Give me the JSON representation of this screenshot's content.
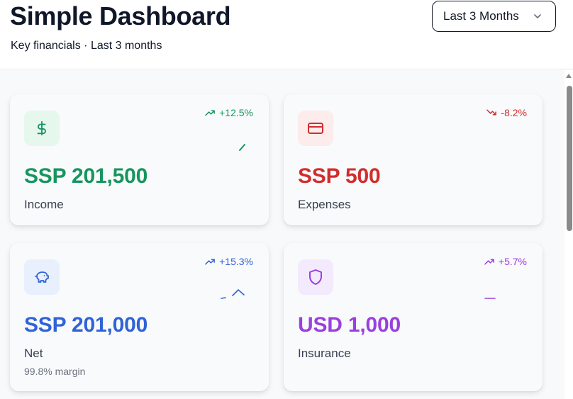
{
  "header": {
    "title": "Simple Dashboard",
    "subtitle": "Key financials · Last 3 months",
    "range_select": {
      "value": "Last 3 Months",
      "icon": "chevron-down-icon"
    }
  },
  "cards": [
    {
      "id": "income",
      "amount": "SSP 201,500",
      "label": "Income",
      "trend": "+12.5%",
      "trend_dir": "up",
      "icon": "dollar-icon",
      "color": "#16955f",
      "icon_bg": "#e6f7ee"
    },
    {
      "id": "expenses",
      "amount": "SSP 500",
      "label": "Expenses",
      "trend": "-8.2%",
      "trend_dir": "down",
      "icon": "credit-card-icon",
      "color": "#d12d2d",
      "icon_bg": "#fdecec"
    },
    {
      "id": "net",
      "amount": "SSP 201,000",
      "label": "Net",
      "sublabel": "99.8% margin",
      "trend": "+15.3%",
      "trend_dir": "up",
      "icon": "piggy-bank-icon",
      "color": "#2f63d8",
      "icon_bg": "#e8effd"
    },
    {
      "id": "insurance",
      "amount": "USD 1,000",
      "label": "Insurance",
      "trend": "+5.7%",
      "trend_dir": "up",
      "icon": "shield-icon",
      "color": "#9a3fe0",
      "icon_bg": "#f3eafd"
    }
  ]
}
